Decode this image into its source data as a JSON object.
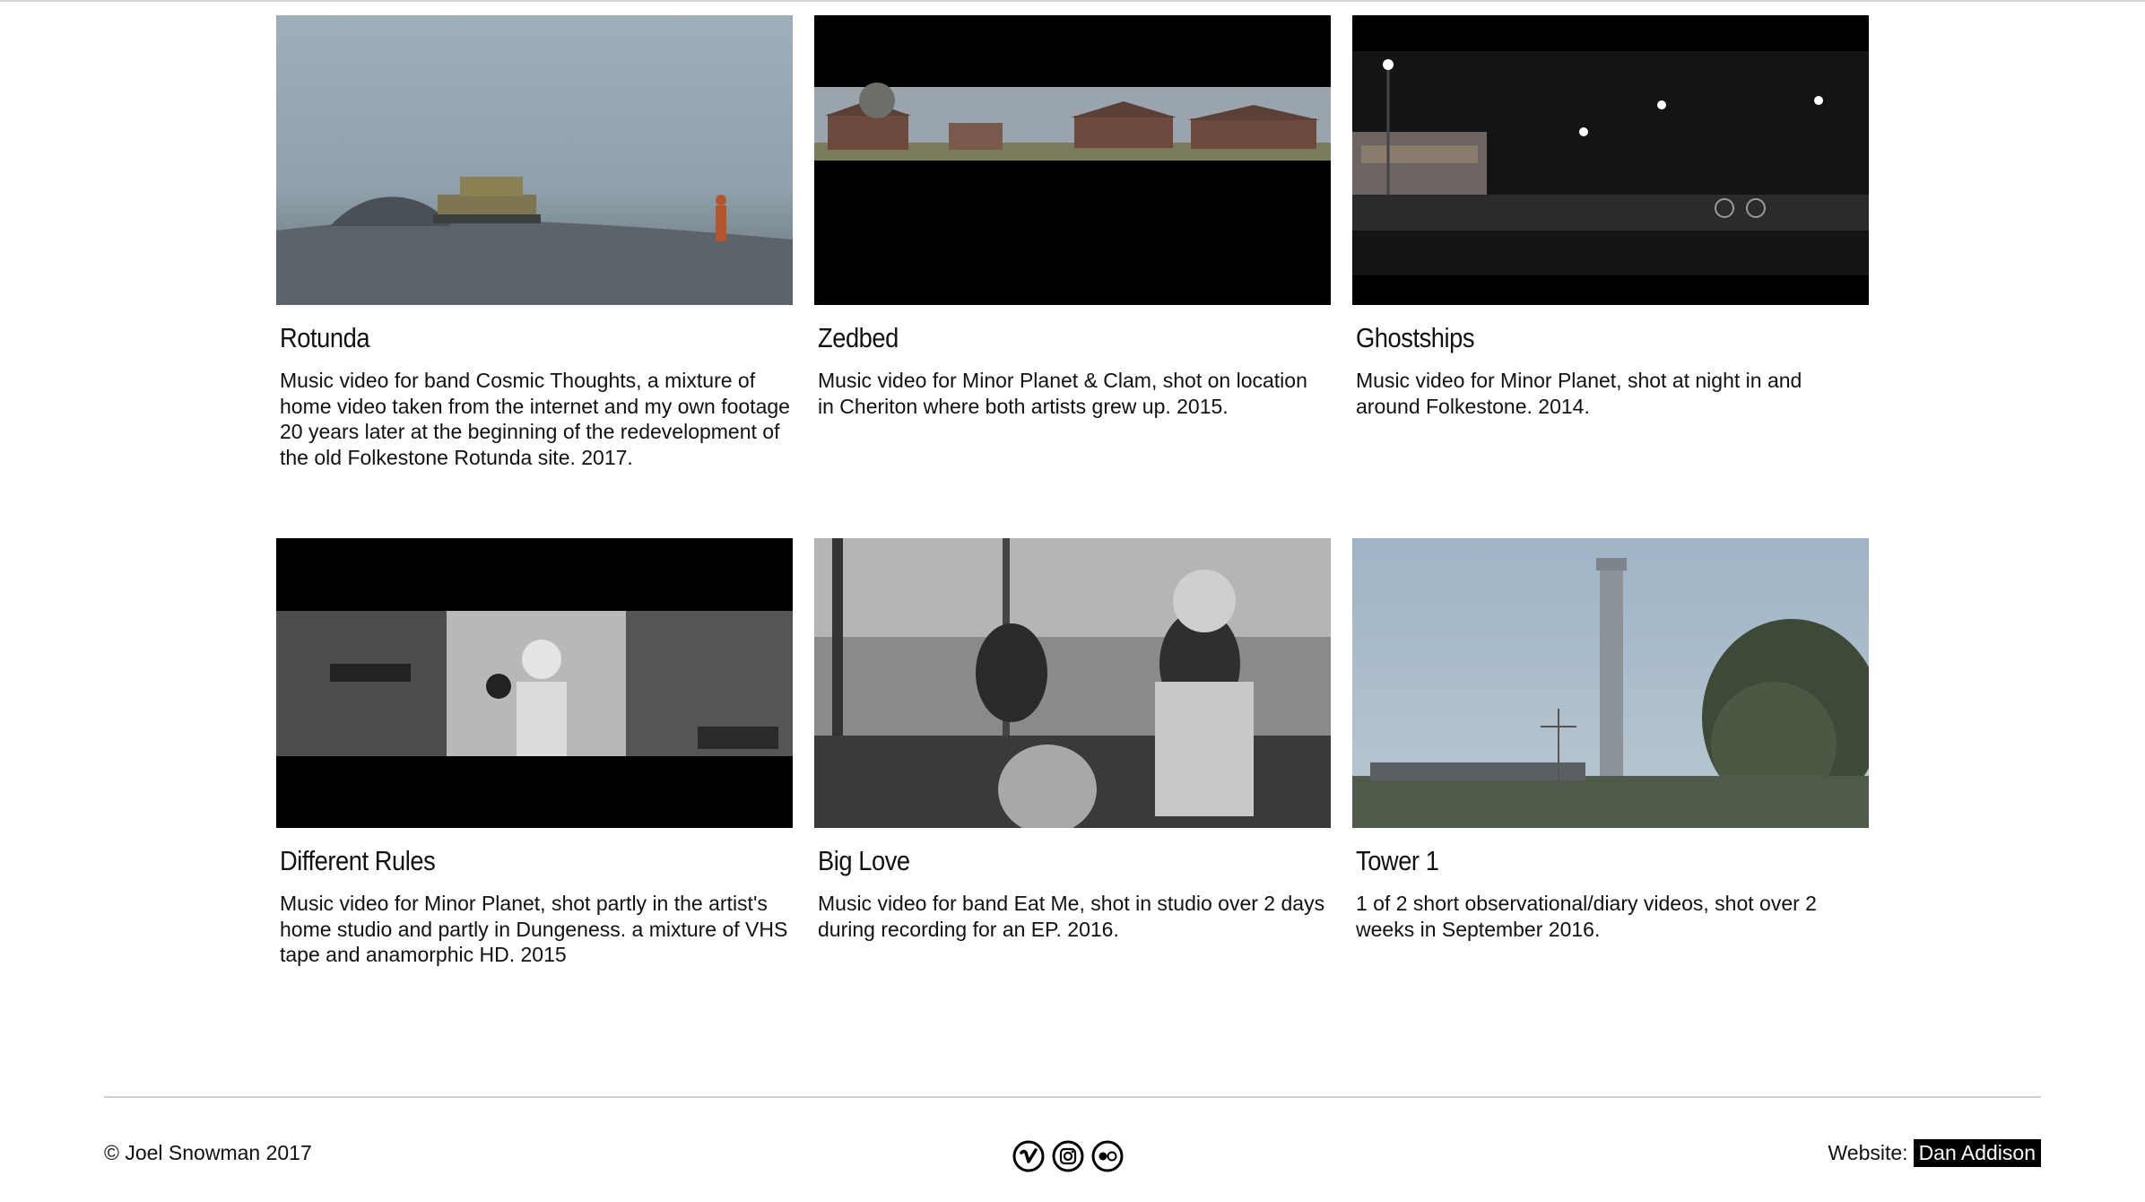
{
  "projects": [
    {
      "title": "Rotunda",
      "description": "Music video for band Cosmic Thoughts, a mixture of home video taken from the internet and my own footage 20 years later at the beginning of the redevelopment of the old Folkestone Rotunda site. 2017."
    },
    {
      "title": "Zedbed",
      "description": "Music video for Minor Planet & Clam, shot on location in Cheriton where both artists grew up. 2015."
    },
    {
      "title": "Ghostships",
      "description": "Music video for Minor Planet, shot at night in and around Folkestone. 2014."
    },
    {
      "title": "Different Rules",
      "description": "Music video for Minor Planet, shot partly in the artist's home studio and partly in Dungeness. a mixture of VHS tape and anamorphic HD. 2015"
    },
    {
      "title": "Big Love",
      "description": "Music video for band Eat Me, shot in studio over 2 days during recording for an EP. 2016."
    },
    {
      "title": "Tower 1",
      "description": "1 of 2 short observational/diary videos, shot over 2 weeks in September 2016."
    }
  ],
  "footer": {
    "copyright": "© Joel Snowman 2017",
    "website_label": "Website:",
    "website_link": "Dan Addison",
    "social_icons": [
      "vimeo-icon",
      "instagram-icon",
      "flickr-icon"
    ]
  }
}
